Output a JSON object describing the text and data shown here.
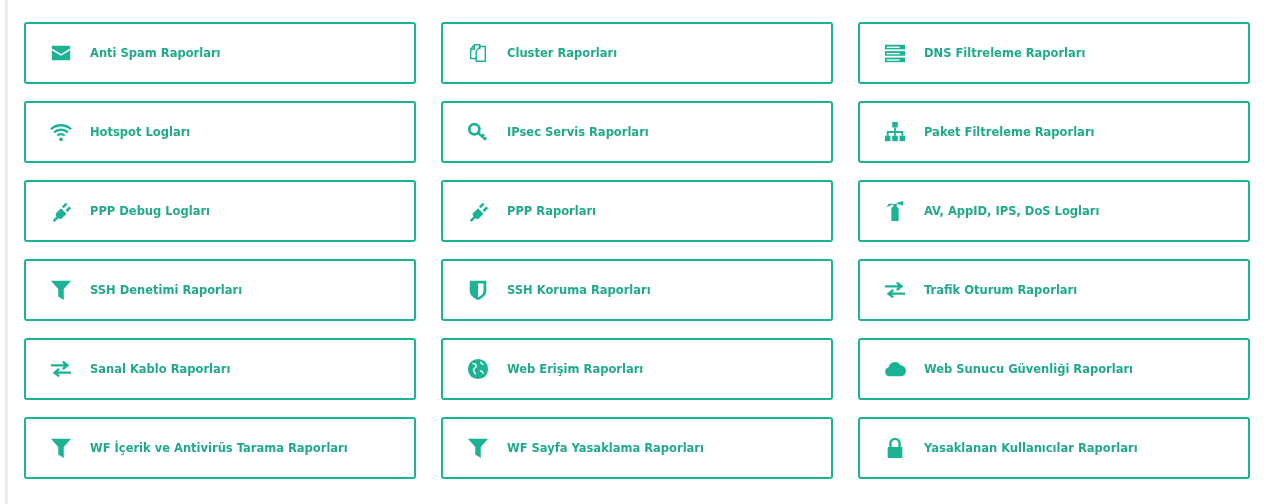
{
  "report_links": [
    {
      "label": "Anti Spam Raporları",
      "kind": "envelope"
    },
    {
      "label": "Cluster Raporları",
      "kind": "files"
    },
    {
      "label": "DNS Filtreleme Raporları",
      "kind": "server"
    },
    {
      "label": "Hotspot Logları",
      "kind": "wifi"
    },
    {
      "label": "IPsec Servis Raporları",
      "kind": "key"
    },
    {
      "label": "Paket Filtreleme Raporları",
      "kind": "sitemap"
    },
    {
      "label": "PPP Debug Logları",
      "kind": "plug"
    },
    {
      "label": "PPP Raporları",
      "kind": "plug"
    },
    {
      "label": "AV, AppID, IPS, DoS Logları",
      "kind": "extinguisher"
    },
    {
      "label": "SSH Denetimi Raporları",
      "kind": "filter"
    },
    {
      "label": "SSH Koruma Raporları",
      "kind": "shield"
    },
    {
      "label": "Trafik Oturum Raporları",
      "kind": "exchange"
    },
    {
      "label": "Sanal Kablo Raporları",
      "kind": "exchange"
    },
    {
      "label": "Web Erişim Raporları",
      "kind": "globe"
    },
    {
      "label": "Web Sunucu Güvenliği Raporları",
      "kind": "cloud"
    },
    {
      "label": "WF İçerik ve Antivirüs Tarama Raporları",
      "kind": "filter"
    },
    {
      "label": "WF Sayfa Yasaklama Raporları",
      "kind": "filter"
    },
    {
      "label": "Yasaklanan Kullanıcılar Raporları",
      "kind": "lock"
    }
  ]
}
